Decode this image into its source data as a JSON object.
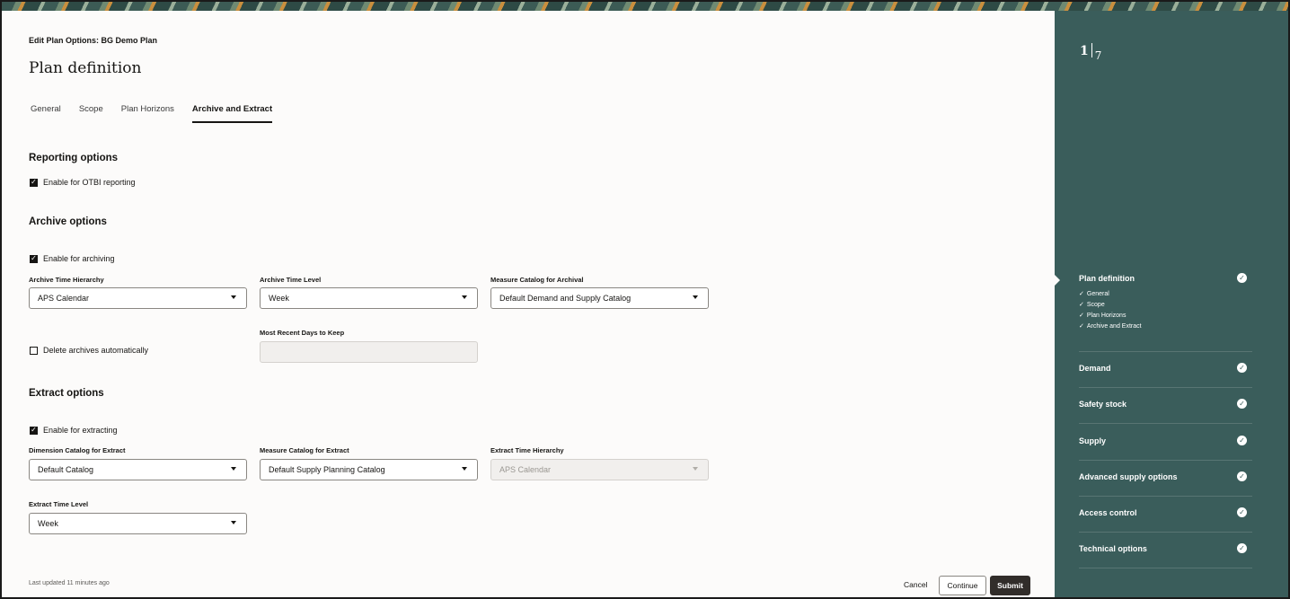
{
  "header": {
    "breadcrumb": "Edit Plan Options: BG Demo Plan",
    "title": "Plan definition"
  },
  "tabs": [
    {
      "label": "General",
      "active": false
    },
    {
      "label": "Scope",
      "active": false
    },
    {
      "label": "Plan Horizons",
      "active": false
    },
    {
      "label": "Archive and Extract",
      "active": true
    }
  ],
  "reporting": {
    "heading": "Reporting options",
    "otbi_label": "Enable for OTBI reporting",
    "otbi_checked": true
  },
  "archive": {
    "heading": "Archive options",
    "enable_label": "Enable for archiving",
    "enable_checked": true,
    "time_hierarchy_label": "Archive Time Hierarchy",
    "time_hierarchy_value": "APS Calendar",
    "time_level_label": "Archive Time Level",
    "time_level_value": "Week",
    "measure_catalog_label": "Measure Catalog for Archival",
    "measure_catalog_value": "Default Demand and Supply Catalog",
    "delete_label": "Delete archives automatically",
    "delete_checked": false,
    "recent_days_label": "Most Recent Days to Keep",
    "recent_days_value": ""
  },
  "extract": {
    "heading": "Extract options",
    "enable_label": "Enable for extracting",
    "enable_checked": true,
    "dimension_catalog_label": "Dimension Catalog for Extract",
    "dimension_catalog_value": "Default Catalog",
    "measure_catalog_label": "Measure Catalog for Extract",
    "measure_catalog_value": "Default Supply Planning Catalog",
    "time_hierarchy_label": "Extract Time Hierarchy",
    "time_hierarchy_value": "APS Calendar",
    "time_level_label": "Extract Time Level",
    "time_level_value": "Week"
  },
  "footer": {
    "last_updated": "Last updated 11 minutes ago",
    "cancel_label": "Cancel",
    "continue_label": "Continue",
    "submit_label": "Submit"
  },
  "progress": {
    "current": "1",
    "total": "7",
    "steps": [
      {
        "label": "Plan definition",
        "complete": true,
        "substeps": [
          "General",
          "Scope",
          "Plan Horizons",
          "Archive and Extract"
        ]
      },
      {
        "label": "Demand",
        "complete": true
      },
      {
        "label": "Safety stock",
        "complete": true
      },
      {
        "label": "Supply",
        "complete": true
      },
      {
        "label": "Advanced supply options",
        "complete": true
      },
      {
        "label": "Access control",
        "complete": true
      },
      {
        "label": "Technical options",
        "complete": true
      }
    ]
  },
  "colors": {
    "rail_background": "#3a5d5b",
    "page_background": "#fcfbfa",
    "primary_button": "#312d2a"
  }
}
